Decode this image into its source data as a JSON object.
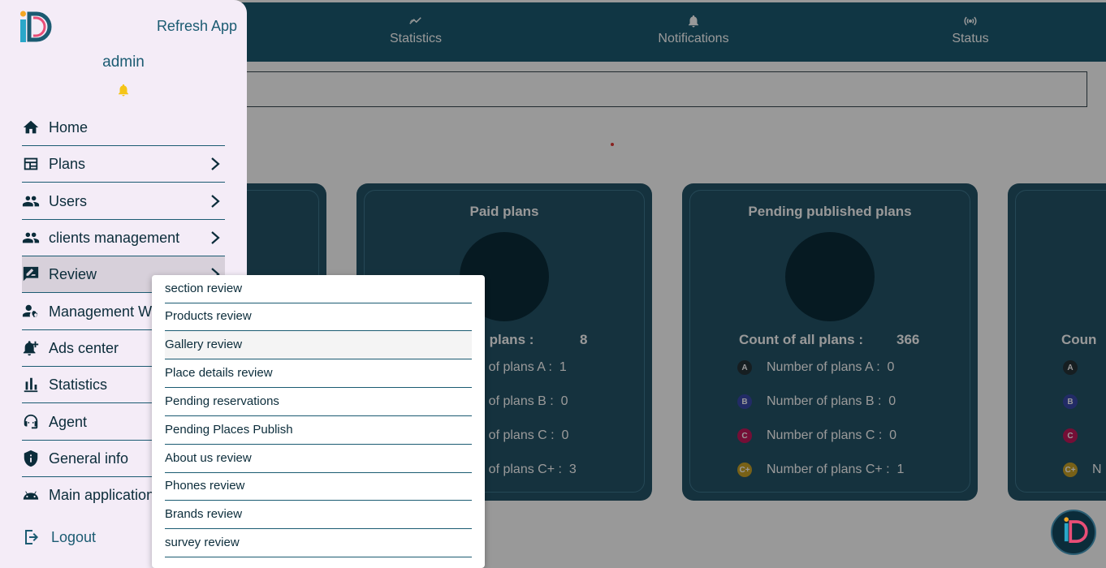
{
  "tabs": [
    {
      "label": "Statistics",
      "icon": "trending-icon"
    },
    {
      "label": "Notifications",
      "icon": "bell-icon"
    },
    {
      "label": "Status",
      "icon": "broadcast-icon"
    }
  ],
  "cards": [
    {
      "title": "",
      "count_label": "",
      "count_value": ""
    },
    {
      "title": "Paid plans",
      "count_label": "all plans :",
      "count_value": "8",
      "rows": [
        {
          "label": "er of plans A :",
          "value": "1"
        },
        {
          "label": "er of plans B :",
          "value": "0"
        },
        {
          "label": "er of plans C :",
          "value": "0"
        },
        {
          "label": "er of plans C+ :",
          "value": "3"
        }
      ]
    },
    {
      "title": "Pending published plans",
      "count_label": "Count of all plans :",
      "count_value": "366",
      "rows": [
        {
          "badge": "A",
          "label": "Number of plans A :",
          "value": "0"
        },
        {
          "badge": "B",
          "label": "Number of plans B :",
          "value": "0"
        },
        {
          "badge": "C",
          "label": "Number of plans C :",
          "value": "0"
        },
        {
          "badge": "C+",
          "label": "Number of plans C+ :",
          "value": "1"
        }
      ]
    },
    {
      "title": "",
      "count_label": "Coun",
      "badges": [
        "A",
        "B",
        "C",
        "C+"
      ],
      "partial": "N"
    }
  ],
  "drawer": {
    "refresh": "Refresh App",
    "username": "admin",
    "nav": [
      {
        "label": "Home",
        "icon": "home-icon",
        "chevron": false
      },
      {
        "label": "Plans",
        "icon": "calendar-icon",
        "chevron": true
      },
      {
        "label": "Users",
        "icon": "users-icon",
        "chevron": true
      },
      {
        "label": "clients management",
        "icon": "users-icon",
        "chevron": true
      },
      {
        "label": "Review",
        "icon": "rate-review-icon",
        "chevron": true,
        "active": true
      },
      {
        "label": "Management Wo",
        "icon": "manage-accounts-icon",
        "chevron": false
      },
      {
        "label": "Ads center",
        "icon": "add-alert-icon",
        "chevron": false
      },
      {
        "label": "Statistics",
        "icon": "bar-chart-icon",
        "chevron": false
      },
      {
        "label": "Agent",
        "icon": "support-agent-icon",
        "chevron": false
      },
      {
        "label": "General info",
        "icon": "shield-icon",
        "chevron": false
      },
      {
        "label": "Main application",
        "icon": "android-icon",
        "chevron": false
      }
    ],
    "logout": "Logout"
  },
  "review_menu": [
    "section review",
    "Products review",
    "Gallery review",
    "Place details review",
    "Pending reservations",
    "Pending Places Publish",
    "About us review",
    "Phones review",
    "Brands review",
    "survey review"
  ],
  "colors": {
    "primary": "#1b5b72",
    "card": "#245468",
    "dark": "#0b2c3a",
    "drawer": "#f4ecf7",
    "badge_a": "#263238",
    "badge_b": "#3949ab",
    "badge_c": "#c2185b",
    "badge_cplus": "#c9a227"
  }
}
